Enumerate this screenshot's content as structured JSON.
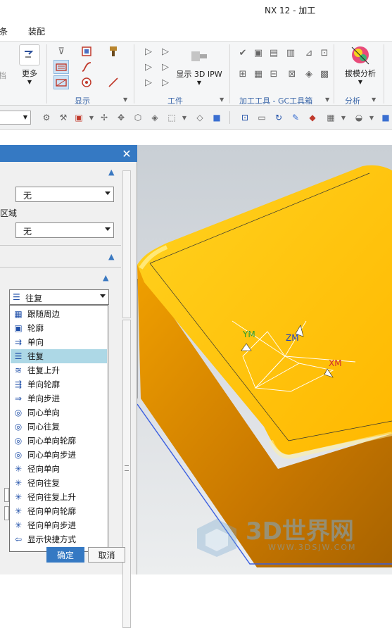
{
  "window": {
    "title": "NX 12 - 加工"
  },
  "menubar": {
    "items": [
      "条",
      "装配"
    ]
  },
  "ribbon": {
    "more_label": "更多",
    "display_group": "显示",
    "show_3d_ipw_label": "显示 3D IPW",
    "workpiece_group": "工件",
    "tools_group": "加工工具 - GC工具箱",
    "draft_analysis_label": "拔模分析",
    "analysis_group": "分析",
    "left_cut_label": "档"
  },
  "dialog": {
    "section1_combo1_value": "无",
    "section1_label2": "区域",
    "section1_combo2_value": "无",
    "cut_pattern_value": "往复",
    "ok_label": "确定",
    "cancel_label": "取消",
    "pattern_options": [
      {
        "label": "跟随周边",
        "icon": "follow-periphery-icon"
      },
      {
        "label": "轮廓",
        "icon": "profile-icon"
      },
      {
        "label": "单向",
        "icon": "zig-icon"
      },
      {
        "label": "往复",
        "icon": "zig-zag-icon",
        "selected": true
      },
      {
        "label": "往复上升",
        "icon": "zig-zag-ramp-icon"
      },
      {
        "label": "单向轮廓",
        "icon": "zig-with-contour-icon"
      },
      {
        "label": "单向步进",
        "icon": "zig-with-step-icon"
      },
      {
        "label": "同心单向",
        "icon": "concentric-zig-icon"
      },
      {
        "label": "同心往复",
        "icon": "concentric-zig-zag-icon"
      },
      {
        "label": "同心单向轮廓",
        "icon": "concentric-zig-contour-icon"
      },
      {
        "label": "同心单向步进",
        "icon": "concentric-zig-step-icon"
      },
      {
        "label": "径向单向",
        "icon": "radial-zig-icon"
      },
      {
        "label": "径向往复",
        "icon": "radial-zig-zag-icon"
      },
      {
        "label": "径向往复上升",
        "icon": "radial-zig-zag-ramp-icon"
      },
      {
        "label": "径向单向轮廓",
        "icon": "radial-zig-contour-icon"
      },
      {
        "label": "径向单向步进",
        "icon": "radial-zig-step-icon"
      },
      {
        "label": "显示快捷方式",
        "icon": "show-shortcuts-icon"
      }
    ]
  },
  "viewport": {
    "axis_xm": "XM",
    "axis_ym": "YM",
    "axis_zm": "ZM",
    "part_color": "#ffc400",
    "edge_color": "#3a5fe0"
  },
  "watermark": {
    "text": "3D世界网",
    "url": "WWW.3DSJW.COM"
  }
}
